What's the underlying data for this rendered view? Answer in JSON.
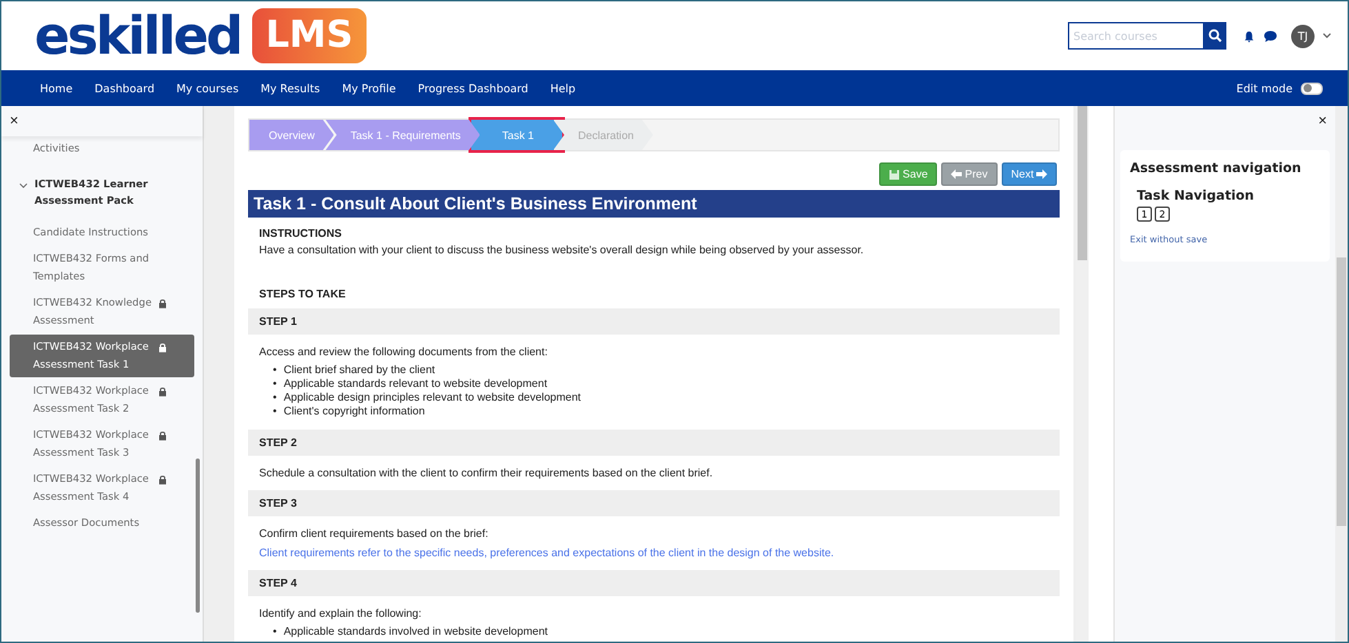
{
  "header": {
    "logo_text": "eskilled",
    "logo_badge": "LMS",
    "search": {
      "placeholder": "Search courses"
    },
    "avatar_initials": "TJ"
  },
  "nav": {
    "items": [
      "Home",
      "Dashboard",
      "My courses",
      "My Results",
      "My Profile",
      "Progress Dashboard",
      "Help"
    ],
    "edit_mode": {
      "label": "Edit mode",
      "on": false
    }
  },
  "sidebar": {
    "close": "×",
    "items": [
      {
        "kind": "item",
        "label": "Activities",
        "locked": false,
        "selected": false
      },
      {
        "kind": "section",
        "label": "ICTWEB432 Learner Assessment Pack",
        "expanded": true,
        "children": [
          {
            "label": "Candidate Instructions",
            "locked": false,
            "selected": false
          },
          {
            "label": "ICTWEB432 Forms and Templates",
            "locked": false,
            "selected": false
          },
          {
            "label": "ICTWEB432 Knowledge Assessment",
            "locked": true,
            "selected": false
          },
          {
            "label": "ICTWEB432 Workplace Assessment Task 1",
            "locked": true,
            "selected": true
          },
          {
            "label": "ICTWEB432 Workplace Assessment Task 2",
            "locked": true,
            "selected": false
          },
          {
            "label": "ICTWEB432 Workplace Assessment Task 3",
            "locked": true,
            "selected": false
          },
          {
            "label": "ICTWEB432 Workplace Assessment Task 4",
            "locked": true,
            "selected": false
          }
        ]
      },
      {
        "kind": "item",
        "label": "Assessor Documents",
        "locked": false,
        "selected": false
      }
    ]
  },
  "steps": [
    {
      "label": "Overview",
      "completed": true,
      "selected": false,
      "highlighted": false
    },
    {
      "label": "Task 1 - Requirements",
      "completed": true,
      "selected": false,
      "highlighted": false
    },
    {
      "label": "Task 1",
      "completed": false,
      "selected": true,
      "highlighted": true
    },
    {
      "label": "Declaration",
      "completed": false,
      "selected": false,
      "highlighted": false
    }
  ],
  "buttons": [
    {
      "kind": "save",
      "label": "Save"
    },
    {
      "kind": "prev",
      "label": "Prev"
    },
    {
      "kind": "next",
      "label": "Next"
    }
  ],
  "task": {
    "title": "Task 1 - Consult About Client's Business Environment",
    "blocks": [
      {
        "kind": "subheading",
        "text": "INSTRUCTIONS"
      },
      {
        "kind": "paragraph",
        "text": "Have a consultation with your client to discuss the business website's overall design while being observed by your assessor."
      },
      {
        "kind": "heading",
        "text": "STEPS TO TAKE"
      },
      {
        "kind": "step",
        "text": "STEP 1"
      },
      {
        "kind": "paragraph",
        "text": "Access and review the following documents from the client:"
      },
      {
        "kind": "list",
        "marker": "•",
        "items": [
          "Client brief shared by the client",
          "Applicable standards relevant to website development",
          "Applicable design principles relevant to website development",
          "Client's copyright information"
        ]
      },
      {
        "kind": "step",
        "text": "STEP 2"
      },
      {
        "kind": "paragraph",
        "text": "Schedule a consultation with the client to confirm their requirements based on the client brief."
      },
      {
        "kind": "step",
        "text": "STEP 3"
      },
      {
        "kind": "paragraph",
        "text": "Confirm client requirements based on the brief:"
      },
      {
        "kind": "note",
        "text": "Client requirements refer to the specific needs, preferences and expectations of the client in the design of the website."
      },
      {
        "kind": "step",
        "text": "STEP 4"
      },
      {
        "kind": "paragraph",
        "text": "Identify and explain the following:"
      },
      {
        "kind": "list",
        "marker": "•",
        "items": [
          "Applicable standards involved in website development"
        ]
      }
    ]
  },
  "drawer": {
    "close": "×",
    "title": "Assessment navigation",
    "subtitle": "Task Navigation",
    "pages": [
      "1",
      "2"
    ],
    "exit_link": "Exit without save"
  }
}
